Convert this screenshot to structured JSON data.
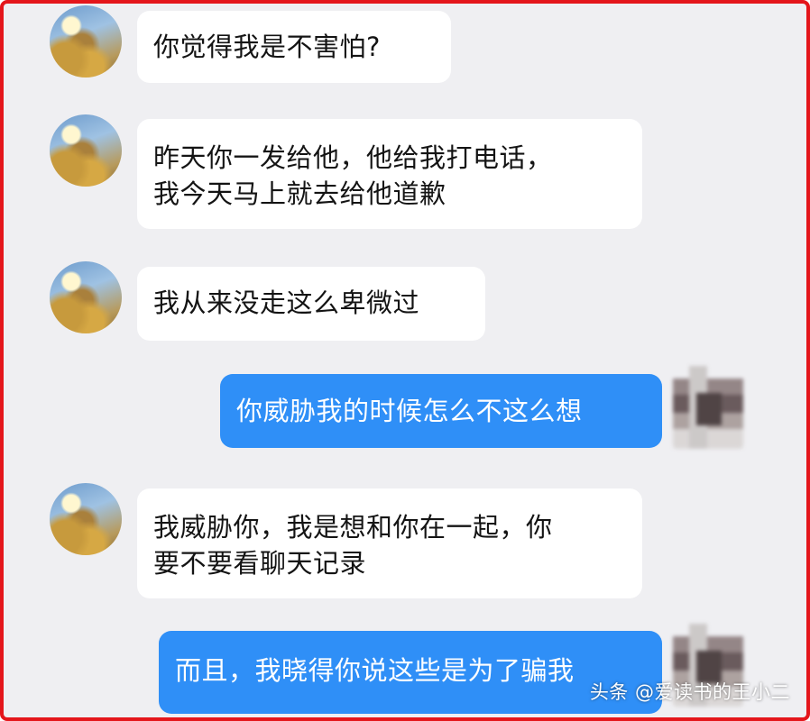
{
  "messages": [
    {
      "side": "left",
      "lines": [
        "你觉得我是不害怕?"
      ]
    },
    {
      "side": "left",
      "lines": [
        "昨天你一发给他，他给我打电话，",
        "我今天马上就去给他道歉"
      ]
    },
    {
      "side": "left",
      "lines": [
        "我从来没走这么卑微过"
      ]
    },
    {
      "side": "right",
      "lines": [
        "你威胁我的时候怎么不这么想"
      ]
    },
    {
      "side": "left",
      "lines": [
        "我威胁你，我是想和你在一起，你",
        "要不要看聊天记录"
      ]
    },
    {
      "side": "right",
      "lines": [
        "而且，我晓得你说这些是为了骗我"
      ]
    }
  ],
  "watermark": "头条 @爱读书的王小二",
  "colors": {
    "border": "#e4161b",
    "background": "#efeff2",
    "outgoing_bubble": "#2f8ff7",
    "incoming_bubble": "#ffffff"
  }
}
